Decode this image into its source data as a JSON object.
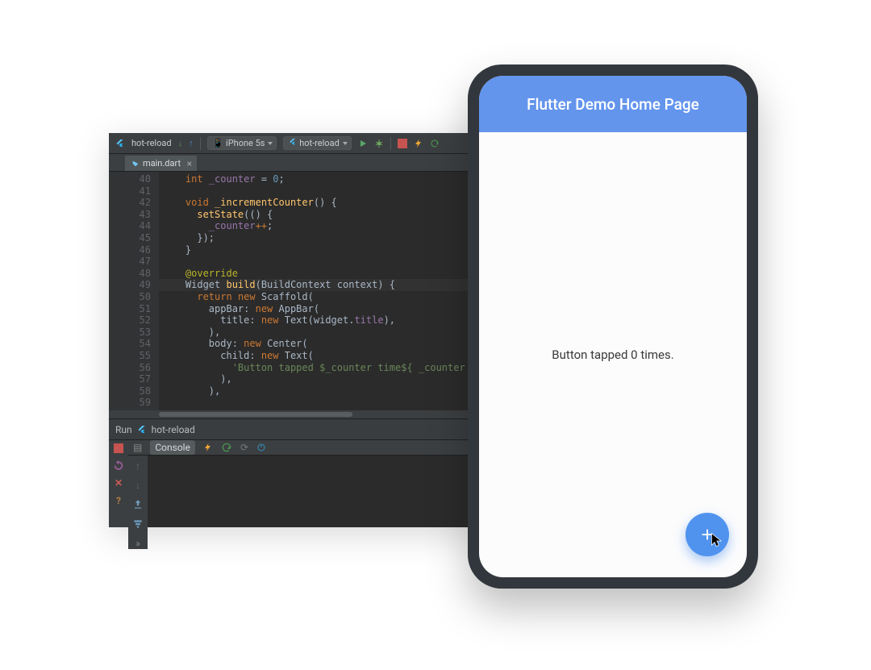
{
  "ide": {
    "project_name": "hot-reload",
    "device": "iPhone 5s",
    "run_config": "hot-reload",
    "file_tab": "main.dart",
    "run_panel": {
      "title_prefix": "Run",
      "title_project": "hot-reload",
      "console_label": "Console"
    },
    "code_lines": [
      {
        "n": 40,
        "tokens": [
          [
            "    ",
            ""
          ],
          [
            "int ",
            "kw"
          ],
          [
            "_counter",
            "id"
          ],
          [
            " = ",
            ""
          ],
          [
            "0",
            "num"
          ],
          [
            ";",
            ""
          ]
        ]
      },
      {
        "n": 41,
        "tokens": [
          [
            "",
            ""
          ]
        ]
      },
      {
        "n": 42,
        "tokens": [
          [
            "    ",
            ""
          ],
          [
            "void ",
            "kw"
          ],
          [
            "_incrementCounter",
            "fn"
          ],
          [
            "() {",
            ""
          ]
        ]
      },
      {
        "n": 43,
        "tokens": [
          [
            "      ",
            ""
          ],
          [
            "setState",
            "fn"
          ],
          [
            "(() {",
            ""
          ]
        ]
      },
      {
        "n": 44,
        "tokens": [
          [
            "        ",
            ""
          ],
          [
            "_counter",
            "id"
          ],
          [
            "++",
            "op"
          ],
          [
            ";",
            ""
          ]
        ]
      },
      {
        "n": 45,
        "tokens": [
          [
            "      });",
            ""
          ]
        ]
      },
      {
        "n": 46,
        "tokens": [
          [
            "    }",
            ""
          ]
        ]
      },
      {
        "n": 47,
        "tokens": [
          [
            "",
            ""
          ]
        ]
      },
      {
        "n": 48,
        "tokens": [
          [
            "    ",
            ""
          ],
          [
            "@override",
            "ann"
          ]
        ]
      },
      {
        "n": 49,
        "hl": true,
        "tokens": [
          [
            "    ",
            ""
          ],
          [
            "Widget ",
            "cls"
          ],
          [
            "build",
            "fn"
          ],
          [
            "(BuildContext context) {",
            ""
          ]
        ]
      },
      {
        "n": 50,
        "tokens": [
          [
            "      ",
            ""
          ],
          [
            "return ",
            "kw"
          ],
          [
            "new ",
            "kw"
          ],
          [
            "Scaffold",
            "cls"
          ],
          [
            "(",
            ""
          ]
        ]
      },
      {
        "n": 51,
        "tokens": [
          [
            "        appBar: ",
            ""
          ],
          [
            "new ",
            "kw"
          ],
          [
            "AppBar",
            "cls"
          ],
          [
            "(",
            ""
          ]
        ]
      },
      {
        "n": 52,
        "tokens": [
          [
            "          title: ",
            ""
          ],
          [
            "new ",
            "kw"
          ],
          [
            "Text",
            "cls"
          ],
          [
            "(widget.",
            ""
          ],
          [
            "title",
            "id"
          ],
          [
            "),",
            ""
          ]
        ]
      },
      {
        "n": 53,
        "tokens": [
          [
            "        ),",
            ""
          ]
        ]
      },
      {
        "n": 54,
        "tokens": [
          [
            "        body: ",
            ""
          ],
          [
            "new ",
            "kw"
          ],
          [
            "Center",
            "cls"
          ],
          [
            "(",
            ""
          ]
        ]
      },
      {
        "n": 55,
        "tokens": [
          [
            "          child: ",
            ""
          ],
          [
            "new ",
            "kw"
          ],
          [
            "Text",
            "cls"
          ],
          [
            "(",
            ""
          ]
        ]
      },
      {
        "n": 56,
        "tokens": [
          [
            "            ",
            ""
          ],
          [
            "'Button tapped $_counter time${ _counter ==",
            "str"
          ]
        ]
      },
      {
        "n": 57,
        "tokens": [
          [
            "          ),",
            ""
          ]
        ]
      },
      {
        "n": 58,
        "tokens": [
          [
            "        ),",
            ""
          ]
        ]
      },
      {
        "n": 59,
        "tokens": [
          [
            "",
            ""
          ]
        ]
      }
    ]
  },
  "app": {
    "title": "Flutter Demo Home Page",
    "body_text": "Button tapped 0 times."
  },
  "icons": {
    "flutter": "flutter-icon",
    "run": "run-icon",
    "debug": "debug-icon",
    "stop": "stop-icon",
    "bolt": "bolt-icon",
    "reload": "reload-icon",
    "plus": "plus-icon"
  }
}
